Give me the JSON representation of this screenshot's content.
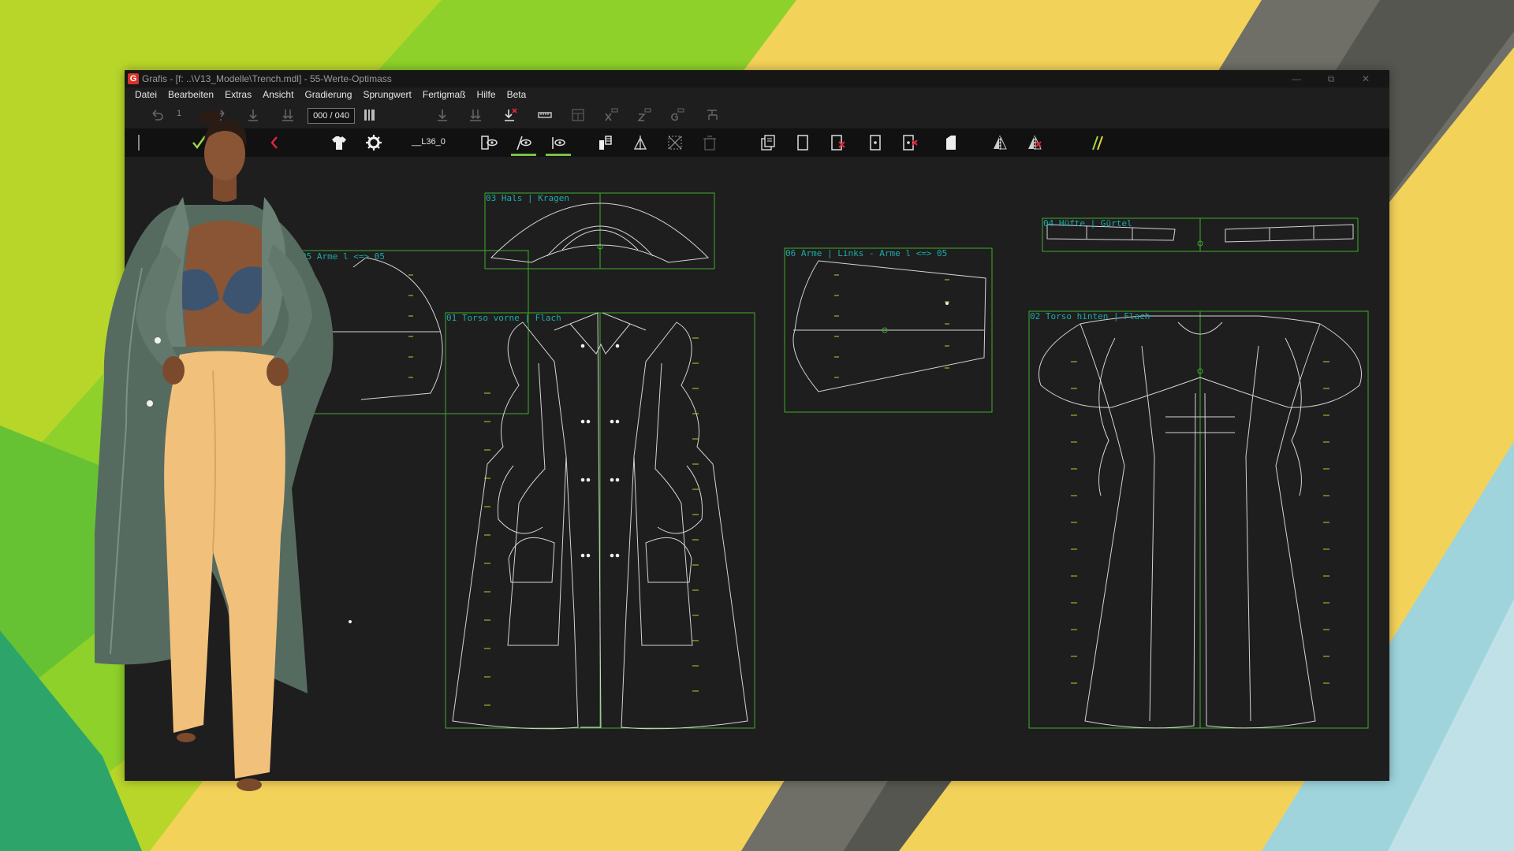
{
  "window": {
    "title": "Grafis - [f: ..\\V13_Modelle\\Trench.mdl] - 55-Werte-Optimass",
    "app_icon_letter": "G",
    "controls": [
      "—",
      "⧉",
      "✕"
    ]
  },
  "menu": [
    "Datei",
    "Bearbeiten",
    "Extras",
    "Ansicht",
    "Gradierung",
    "Sprungwert",
    "Fertigmaß",
    "Hilfe",
    "Beta"
  ],
  "toolbar1": {
    "step_value": "1",
    "counter": "000 / 040",
    "icons": [
      "undo-icon",
      "redo-icon",
      "step-down-icon",
      "double-step-down-icon",
      "bars-icon",
      "down-icon",
      "double-down-icon",
      "delete-step-icon",
      "ruler-icon",
      "frame-icon",
      "x-value-icon",
      "z-value-icon",
      "g-value-icon",
      "tree-icon"
    ]
  },
  "toolbar2": {
    "size_label": "__L36_0",
    "icons": [
      "checkmark-icon",
      "back-arrow-icon",
      "shirt-icon",
      "settings-icon",
      "view-eye-icon",
      "draw-eye-icon",
      "pin-eye-icon",
      "stack-icon",
      "mirror-icon",
      "grid-icon",
      "trash-icon",
      "copy-page-icon",
      "blank-page-icon",
      "delete-page-icon",
      "point-page-icon",
      "delete-point-icon",
      "fold-icon",
      "mirror-piece-icon",
      "mirror-delete-icon",
      "measure-pen-icon"
    ],
    "colors": {
      "accent": "#7bc144",
      "check": "#9bd84a",
      "alert": "#e0283a"
    }
  },
  "pieces": [
    {
      "id": "03",
      "label": "03 Hals | Kragen"
    },
    {
      "id": "05",
      "label": "05 Arme l <=> 05"
    },
    {
      "id": "06",
      "label": "06 Arme | Links - Arme l <=> 05"
    },
    {
      "id": "04",
      "label": "04 Hüfte | Gürtel"
    },
    {
      "id": "01",
      "label": "01 Torso vorne | Flach"
    },
    {
      "id": "02",
      "label": "02 Torso hinten | Flach"
    }
  ],
  "canvas_colors": {
    "frame": "#3fae2a",
    "line": "#d4d4d4",
    "mark": "#c8c82a",
    "label": "#1fa8a8"
  }
}
